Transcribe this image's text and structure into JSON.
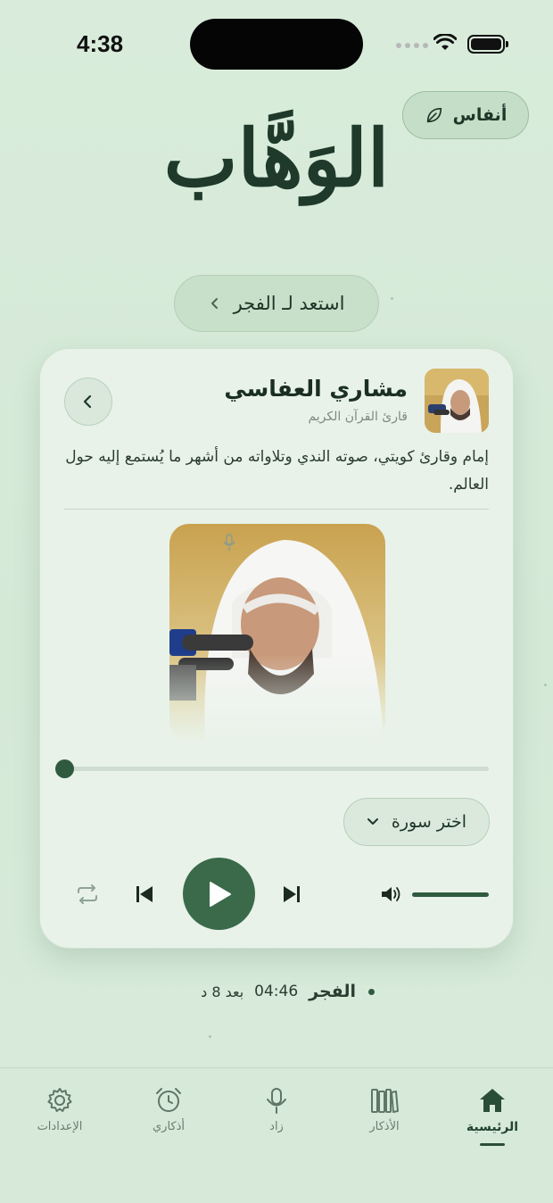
{
  "status_bar": {
    "time": "4:38"
  },
  "app_badge": {
    "label": "أنفاس"
  },
  "divine_name": "الوَهَّاب",
  "prep_pill": {
    "label": "استعد لـ الفجر"
  },
  "reciter": {
    "name": "مشاري العفاسي",
    "subtitle": "قارئ القرآن الكريم",
    "bio": "إمام وقارئ كويتي، صوته الندي وتلاواته من أشهر ما يُستمع إليه حول العالم."
  },
  "player": {
    "progress": 0,
    "volume": 1,
    "surah_select_label": "اختر سورة"
  },
  "next_prayer": {
    "name": "الفجر",
    "time": "04:46",
    "remaining": "بعد 8 د"
  },
  "tabs": [
    {
      "label": "الرئيسية",
      "icon": "home-icon",
      "active": true
    },
    {
      "label": "الأذكار",
      "icon": "books-icon",
      "active": false
    },
    {
      "label": "زاد",
      "icon": "microphone-icon",
      "active": false
    },
    {
      "label": "أذكاري",
      "icon": "alarm-clock-icon",
      "active": false
    },
    {
      "label": "الإعدادات",
      "icon": "gear-icon",
      "active": false
    }
  ],
  "colors": {
    "accent": "#3a6a49",
    "background": "#d8ead9",
    "card": "#e8f2e9"
  }
}
